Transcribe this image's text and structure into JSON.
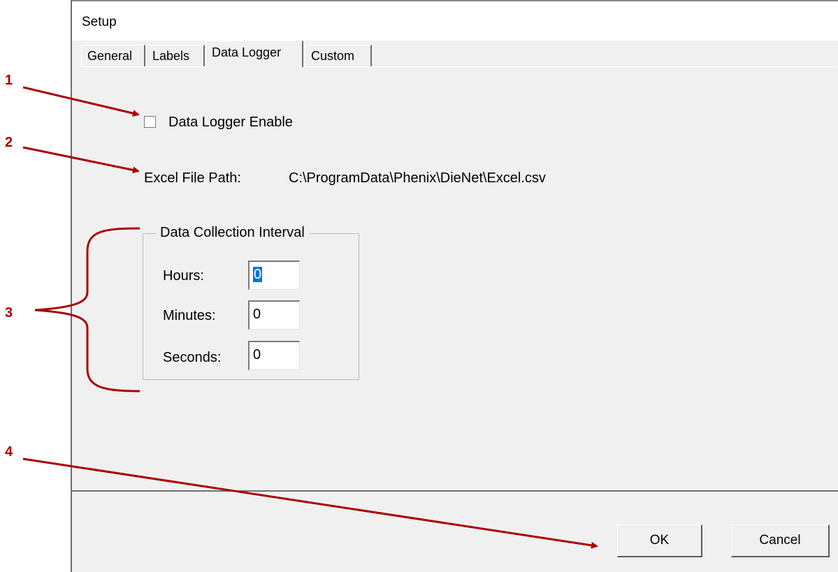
{
  "window": {
    "title": "Setup"
  },
  "tabs": [
    {
      "label": "General",
      "active": false
    },
    {
      "label": "Labels",
      "active": false
    },
    {
      "label": "Data Logger",
      "active": true
    },
    {
      "label": "Custom",
      "active": false
    }
  ],
  "data_logger": {
    "enable_label": "Data Logger Enable",
    "enable_checked": false,
    "path_label": "Excel File Path:",
    "path_value": "C:\\ProgramData\\Phenix\\DieNet\\Excel.csv"
  },
  "interval": {
    "legend": "Data Collection Interval",
    "fields": [
      {
        "label": "Hours:",
        "value": "0",
        "selected": true
      },
      {
        "label": "Minutes:",
        "value": "0",
        "selected": false
      },
      {
        "label": "Seconds:",
        "value": "0",
        "selected": false
      }
    ]
  },
  "buttons": {
    "ok": "OK",
    "cancel": "Cancel"
  },
  "annotations": {
    "color": "#aa0000",
    "labels": [
      "1",
      "2",
      "3",
      "4"
    ]
  }
}
